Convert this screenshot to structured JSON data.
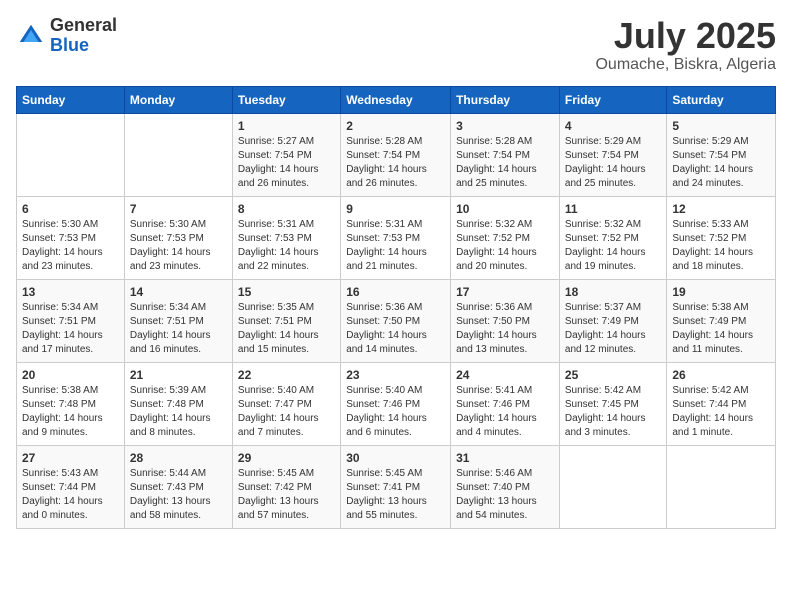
{
  "header": {
    "logo_general": "General",
    "logo_blue": "Blue",
    "month": "July 2025",
    "location": "Oumache, Biskra, Algeria"
  },
  "days_of_week": [
    "Sunday",
    "Monday",
    "Tuesday",
    "Wednesday",
    "Thursday",
    "Friday",
    "Saturday"
  ],
  "weeks": [
    [
      {
        "num": "",
        "detail": ""
      },
      {
        "num": "",
        "detail": ""
      },
      {
        "num": "1",
        "detail": "Sunrise: 5:27 AM\nSunset: 7:54 PM\nDaylight: 14 hours and 26 minutes."
      },
      {
        "num": "2",
        "detail": "Sunrise: 5:28 AM\nSunset: 7:54 PM\nDaylight: 14 hours and 26 minutes."
      },
      {
        "num": "3",
        "detail": "Sunrise: 5:28 AM\nSunset: 7:54 PM\nDaylight: 14 hours and 25 minutes."
      },
      {
        "num": "4",
        "detail": "Sunrise: 5:29 AM\nSunset: 7:54 PM\nDaylight: 14 hours and 25 minutes."
      },
      {
        "num": "5",
        "detail": "Sunrise: 5:29 AM\nSunset: 7:54 PM\nDaylight: 14 hours and 24 minutes."
      }
    ],
    [
      {
        "num": "6",
        "detail": "Sunrise: 5:30 AM\nSunset: 7:53 PM\nDaylight: 14 hours and 23 minutes."
      },
      {
        "num": "7",
        "detail": "Sunrise: 5:30 AM\nSunset: 7:53 PM\nDaylight: 14 hours and 23 minutes."
      },
      {
        "num": "8",
        "detail": "Sunrise: 5:31 AM\nSunset: 7:53 PM\nDaylight: 14 hours and 22 minutes."
      },
      {
        "num": "9",
        "detail": "Sunrise: 5:31 AM\nSunset: 7:53 PM\nDaylight: 14 hours and 21 minutes."
      },
      {
        "num": "10",
        "detail": "Sunrise: 5:32 AM\nSunset: 7:52 PM\nDaylight: 14 hours and 20 minutes."
      },
      {
        "num": "11",
        "detail": "Sunrise: 5:32 AM\nSunset: 7:52 PM\nDaylight: 14 hours and 19 minutes."
      },
      {
        "num": "12",
        "detail": "Sunrise: 5:33 AM\nSunset: 7:52 PM\nDaylight: 14 hours and 18 minutes."
      }
    ],
    [
      {
        "num": "13",
        "detail": "Sunrise: 5:34 AM\nSunset: 7:51 PM\nDaylight: 14 hours and 17 minutes."
      },
      {
        "num": "14",
        "detail": "Sunrise: 5:34 AM\nSunset: 7:51 PM\nDaylight: 14 hours and 16 minutes."
      },
      {
        "num": "15",
        "detail": "Sunrise: 5:35 AM\nSunset: 7:51 PM\nDaylight: 14 hours and 15 minutes."
      },
      {
        "num": "16",
        "detail": "Sunrise: 5:36 AM\nSunset: 7:50 PM\nDaylight: 14 hours and 14 minutes."
      },
      {
        "num": "17",
        "detail": "Sunrise: 5:36 AM\nSunset: 7:50 PM\nDaylight: 14 hours and 13 minutes."
      },
      {
        "num": "18",
        "detail": "Sunrise: 5:37 AM\nSunset: 7:49 PM\nDaylight: 14 hours and 12 minutes."
      },
      {
        "num": "19",
        "detail": "Sunrise: 5:38 AM\nSunset: 7:49 PM\nDaylight: 14 hours and 11 minutes."
      }
    ],
    [
      {
        "num": "20",
        "detail": "Sunrise: 5:38 AM\nSunset: 7:48 PM\nDaylight: 14 hours and 9 minutes."
      },
      {
        "num": "21",
        "detail": "Sunrise: 5:39 AM\nSunset: 7:48 PM\nDaylight: 14 hours and 8 minutes."
      },
      {
        "num": "22",
        "detail": "Sunrise: 5:40 AM\nSunset: 7:47 PM\nDaylight: 14 hours and 7 minutes."
      },
      {
        "num": "23",
        "detail": "Sunrise: 5:40 AM\nSunset: 7:46 PM\nDaylight: 14 hours and 6 minutes."
      },
      {
        "num": "24",
        "detail": "Sunrise: 5:41 AM\nSunset: 7:46 PM\nDaylight: 14 hours and 4 minutes."
      },
      {
        "num": "25",
        "detail": "Sunrise: 5:42 AM\nSunset: 7:45 PM\nDaylight: 14 hours and 3 minutes."
      },
      {
        "num": "26",
        "detail": "Sunrise: 5:42 AM\nSunset: 7:44 PM\nDaylight: 14 hours and 1 minute."
      }
    ],
    [
      {
        "num": "27",
        "detail": "Sunrise: 5:43 AM\nSunset: 7:44 PM\nDaylight: 14 hours and 0 minutes."
      },
      {
        "num": "28",
        "detail": "Sunrise: 5:44 AM\nSunset: 7:43 PM\nDaylight: 13 hours and 58 minutes."
      },
      {
        "num": "29",
        "detail": "Sunrise: 5:45 AM\nSunset: 7:42 PM\nDaylight: 13 hours and 57 minutes."
      },
      {
        "num": "30",
        "detail": "Sunrise: 5:45 AM\nSunset: 7:41 PM\nDaylight: 13 hours and 55 minutes."
      },
      {
        "num": "31",
        "detail": "Sunrise: 5:46 AM\nSunset: 7:40 PM\nDaylight: 13 hours and 54 minutes."
      },
      {
        "num": "",
        "detail": ""
      },
      {
        "num": "",
        "detail": ""
      }
    ]
  ]
}
